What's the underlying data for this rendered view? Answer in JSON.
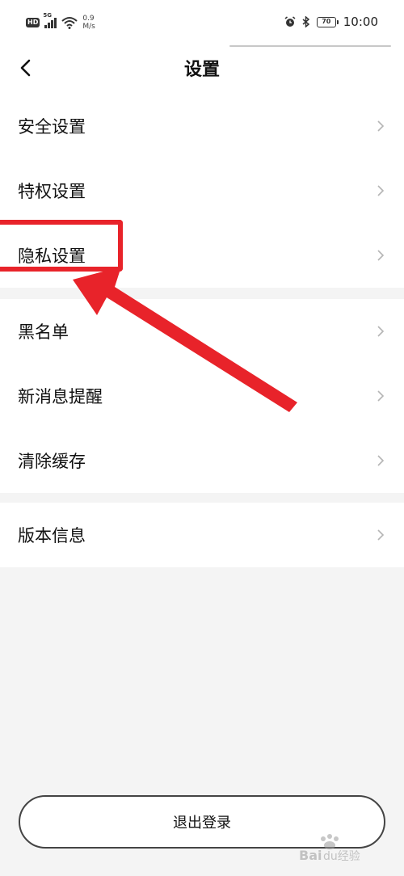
{
  "status_bar": {
    "hd": "HD",
    "network": "5G",
    "speed_value": "0.9",
    "speed_unit": "M/s",
    "battery": "70",
    "time": "10:00"
  },
  "header": {
    "title": "设置"
  },
  "groups": [
    {
      "items": [
        {
          "label": "安全设置"
        },
        {
          "label": "特权设置"
        },
        {
          "label": "隐私设置"
        }
      ]
    },
    {
      "items": [
        {
          "label": "黑名单"
        },
        {
          "label": "新消息提醒"
        },
        {
          "label": "清除缓存"
        }
      ]
    },
    {
      "items": [
        {
          "label": "版本信息"
        }
      ]
    }
  ],
  "logout": {
    "label": "退出登录"
  },
  "annotation": {
    "color": "#e8232a"
  },
  "watermark": {
    "text": "Baidu经验"
  },
  "icons": [
    "back-icon",
    "chevron-right-icon",
    "wifi-icon",
    "alarm-icon",
    "bluetooth-icon",
    "battery-icon"
  ]
}
